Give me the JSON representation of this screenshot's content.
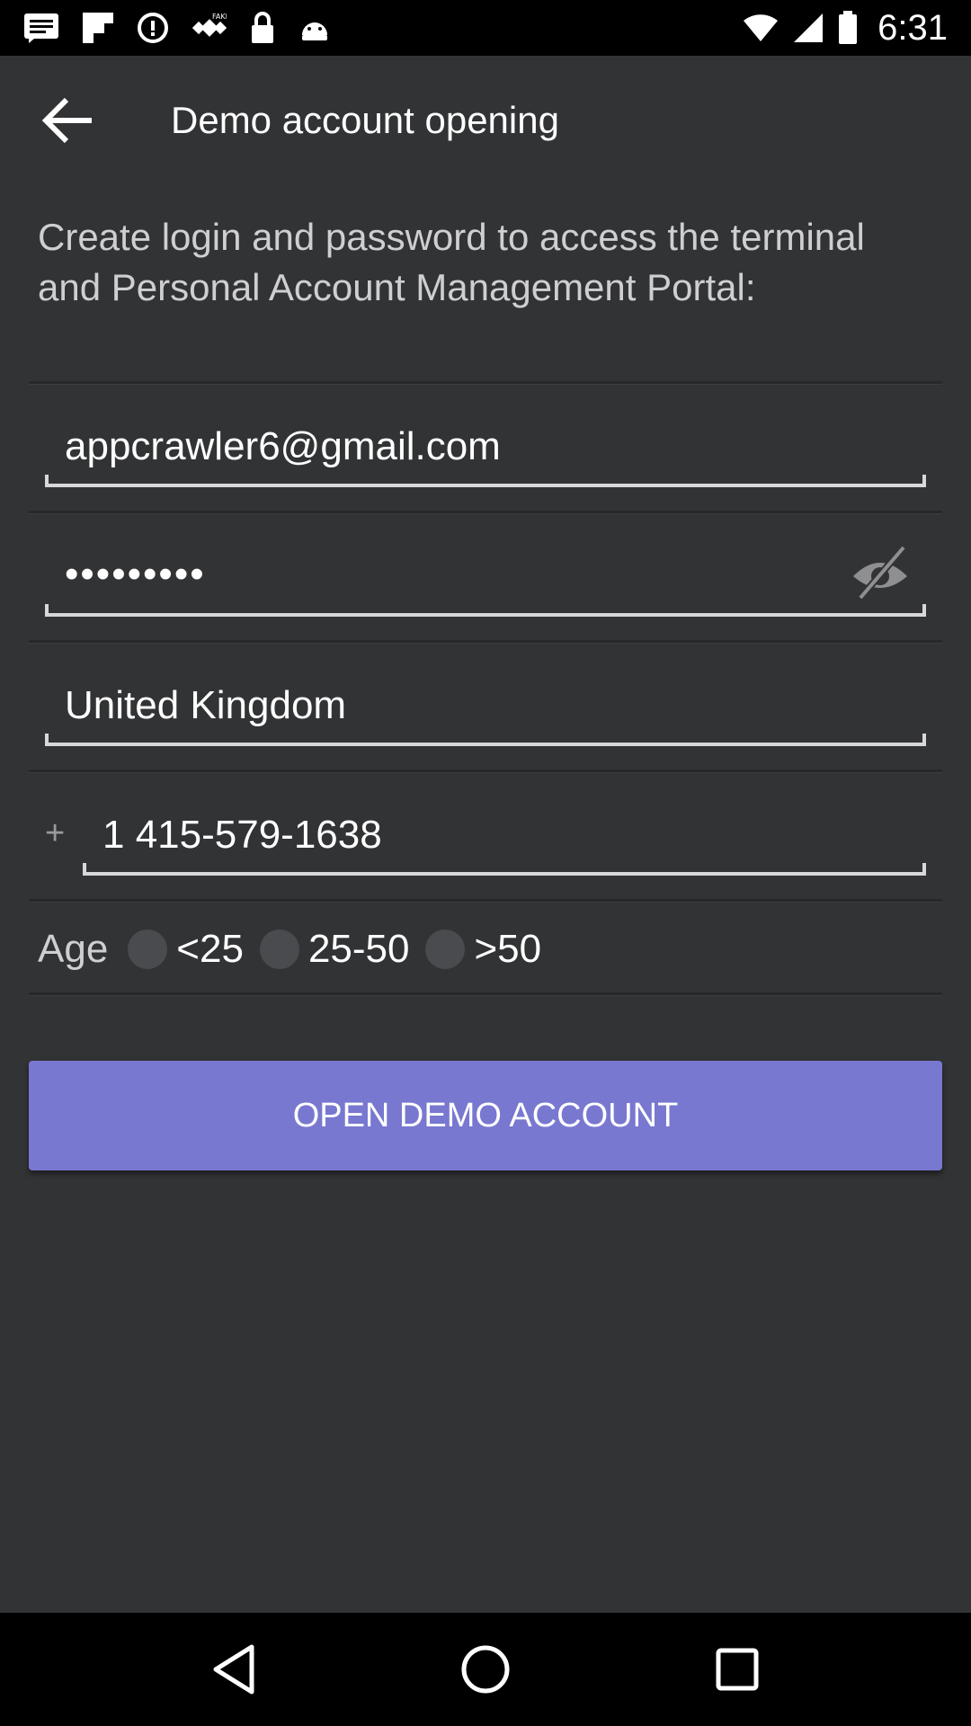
{
  "status_bar": {
    "time": "6:31",
    "left_icons": [
      "message-icon",
      "flipboard-icon",
      "data-saver-icon",
      "fake-gps-icon",
      "lock-icon",
      "android-icon"
    ],
    "right_icons": [
      "wifi-icon",
      "signal-icon",
      "battery-icon"
    ]
  },
  "app_bar": {
    "title": "Demo account opening",
    "back_icon": "arrow-back-icon"
  },
  "intro_text": "Create login and password to access the terminal and Personal Account Management Portal:",
  "form": {
    "email": "appcrawler6@gmail.com",
    "password": "•••••••••",
    "password_toggle_icon": "visibility-off-icon",
    "country": "United Kingdom",
    "phone_prefix": "+",
    "phone": "1 415-579-1638",
    "age": {
      "label": "Age",
      "options": [
        "<25",
        "25-50",
        ">50"
      ]
    }
  },
  "submit_label": "OPEN DEMO ACCOUNT",
  "nav_bar": {
    "icons": [
      "back-triangle-icon",
      "home-circle-icon",
      "recents-square-icon"
    ]
  },
  "colors": {
    "background": "#323335",
    "button": "#7878d1",
    "bars": "#000000"
  }
}
